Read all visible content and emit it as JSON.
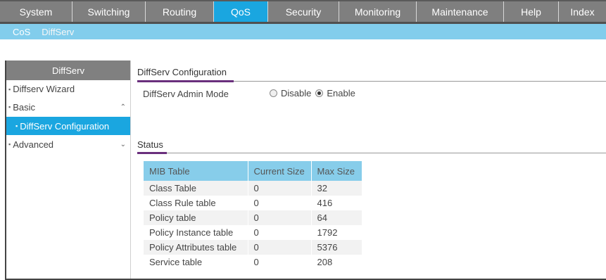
{
  "topnav": {
    "tabs": [
      {
        "label": "System"
      },
      {
        "label": "Switching"
      },
      {
        "label": "Routing"
      },
      {
        "label": "QoS"
      },
      {
        "label": "Security"
      },
      {
        "label": "Monitoring"
      },
      {
        "label": "Maintenance"
      },
      {
        "label": "Help"
      },
      {
        "label": "Index"
      }
    ],
    "active": "QoS"
  },
  "subnav": {
    "items": [
      {
        "label": "CoS"
      },
      {
        "label": "DiffServ"
      }
    ],
    "active": "DiffServ"
  },
  "sidebar": {
    "header": "DiffServ",
    "items": [
      {
        "label": "Diffserv Wizard"
      },
      {
        "label": "Basic"
      },
      {
        "label": "DiffServ Configuration"
      },
      {
        "label": "Advanced"
      }
    ],
    "active": "DiffServ Configuration"
  },
  "config": {
    "title": "DiffServ Configuration",
    "admin_mode_label": "DiffServ Admin Mode",
    "options": [
      {
        "label": "Disable",
        "selected": false
      },
      {
        "label": "Enable",
        "selected": true
      }
    ]
  },
  "status": {
    "title": "Status",
    "columns": [
      "MIB Table",
      "Current Size",
      "Max Size"
    ],
    "rows": [
      [
        "Class Table",
        "0",
        "32"
      ],
      [
        "Class Rule table",
        "0",
        "416"
      ],
      [
        "Policy table",
        "0",
        "64"
      ],
      [
        "Policy Instance table",
        "0",
        "1792"
      ],
      [
        "Policy Attributes table",
        "0",
        "5376"
      ],
      [
        "Service table",
        "0",
        "208"
      ]
    ]
  },
  "colors": {
    "nav_bg": "#7f7f7f",
    "active_blue": "#1aa6e0",
    "subnav_bg": "#82cdec",
    "accent_purple": "#6a2f7d",
    "table_header": "#87cdea"
  }
}
